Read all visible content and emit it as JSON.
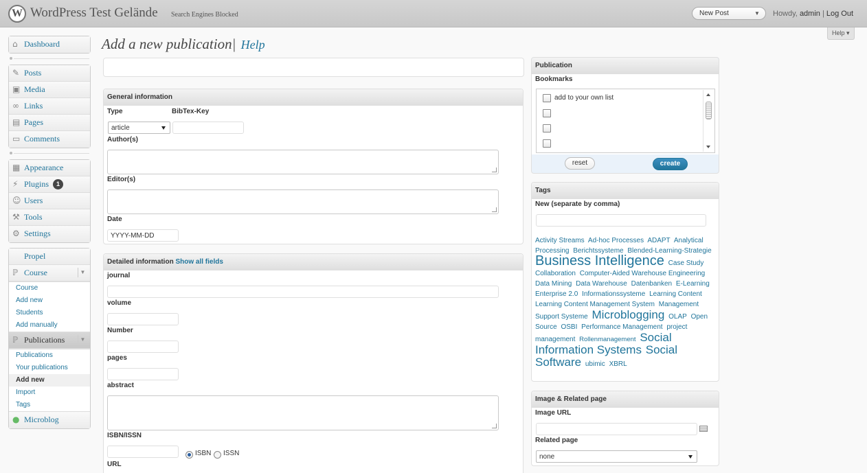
{
  "header": {
    "site_title": "WordPress Test Gelände",
    "tagline": "Search Engines Blocked",
    "new_post": "New Post",
    "howdy": "Howdy,",
    "user": "admin",
    "separator": "|",
    "logout": "Log Out",
    "help": "Help"
  },
  "sidebar": {
    "dashboard": "Dashboard",
    "posts": "Posts",
    "media": "Media",
    "links": "Links",
    "pages": "Pages",
    "comments": "Comments",
    "appearance": "Appearance",
    "plugins": "Plugins",
    "plugins_badge": "1",
    "users": "Users",
    "tools": "Tools",
    "settings": "Settings",
    "propel": "Propel",
    "course": "Course",
    "course_sub": [
      "Course",
      "Add new",
      "Students",
      "Add manually"
    ],
    "publications": "Publications",
    "publications_sub": [
      "Publications",
      "Your publications",
      "Add new",
      "Import",
      "Tags"
    ],
    "microblog": "Microblog"
  },
  "main": {
    "title": "Add a new publication|",
    "help_link": "Help",
    "general": {
      "heading": "General information",
      "type_label": "Type",
      "type_value": "article",
      "bibtex_label": "BibTex-Key",
      "authors_label": "Author(s)",
      "editors_label": "Editor(s)",
      "date_label": "Date",
      "date_value": "YYYY-MM-DD"
    },
    "detailed": {
      "heading": "Detailed information",
      "show_all": "Show all fields",
      "journal": "journal",
      "volume": "volume",
      "number": "Number",
      "pages": "pages",
      "abstract": "abstract",
      "isbn_issn": "ISBN/ISSN",
      "isbn": "ISBN",
      "issn": "ISSN",
      "url": "URL"
    }
  },
  "right": {
    "publication": {
      "heading": "Publication",
      "bookmarks": "Bookmarks",
      "add_own_list": "add to your own list",
      "reset": "reset",
      "create": "create"
    },
    "tags": {
      "heading": "Tags",
      "new_label": "New (separate by comma)",
      "cloud": [
        {
          "t": "Activity Streams",
          "s": "n"
        },
        {
          "t": "Ad-hoc Processes",
          "s": "n"
        },
        {
          "t": "ADAPT",
          "s": "n"
        },
        {
          "t": "Analytical Processing",
          "s": "n"
        },
        {
          "t": "Berichtssysteme",
          "s": "n"
        },
        {
          "t": "Blended-Learning-Strategie",
          "s": "n"
        },
        {
          "t": "Business Intelligence",
          "s": "big"
        },
        {
          "t": "Case Study",
          "s": "n"
        },
        {
          "t": "Collaboration",
          "s": "n"
        },
        {
          "t": "Computer-Aided Warehouse Engineering",
          "s": "n"
        },
        {
          "t": "Data Mining",
          "s": "n"
        },
        {
          "t": "Data Warehouse",
          "s": "n"
        },
        {
          "t": "Datenbanken",
          "s": "n"
        },
        {
          "t": "E-Learning",
          "s": "n"
        },
        {
          "t": "Enterprise 2.0",
          "s": "n"
        },
        {
          "t": "Informationssysteme",
          "s": "n"
        },
        {
          "t": "Learning Content",
          "s": "n"
        },
        {
          "t": "Learning Content Management System",
          "s": "n"
        },
        {
          "t": "Management Support Systeme",
          "s": "n"
        },
        {
          "t": "Microblogging",
          "s": "mid"
        },
        {
          "t": "OLAP",
          "s": "n"
        },
        {
          "t": "Open Source",
          "s": "n"
        },
        {
          "t": "OSBI",
          "s": "n"
        },
        {
          "t": "Performance Management",
          "s": "n"
        },
        {
          "t": "project management",
          "s": "n"
        },
        {
          "t": "Rollenmanagement",
          "s": "sm"
        },
        {
          "t": "Social Information Systems",
          "s": "mid"
        },
        {
          "t": "Social Software",
          "s": "mid"
        },
        {
          "t": "ubimic",
          "s": "n"
        },
        {
          "t": "XBRL",
          "s": "n"
        }
      ]
    },
    "image": {
      "heading": "Image & Related page",
      "image_url": "Image URL",
      "related_page": "Related page",
      "related_value": "none"
    }
  }
}
